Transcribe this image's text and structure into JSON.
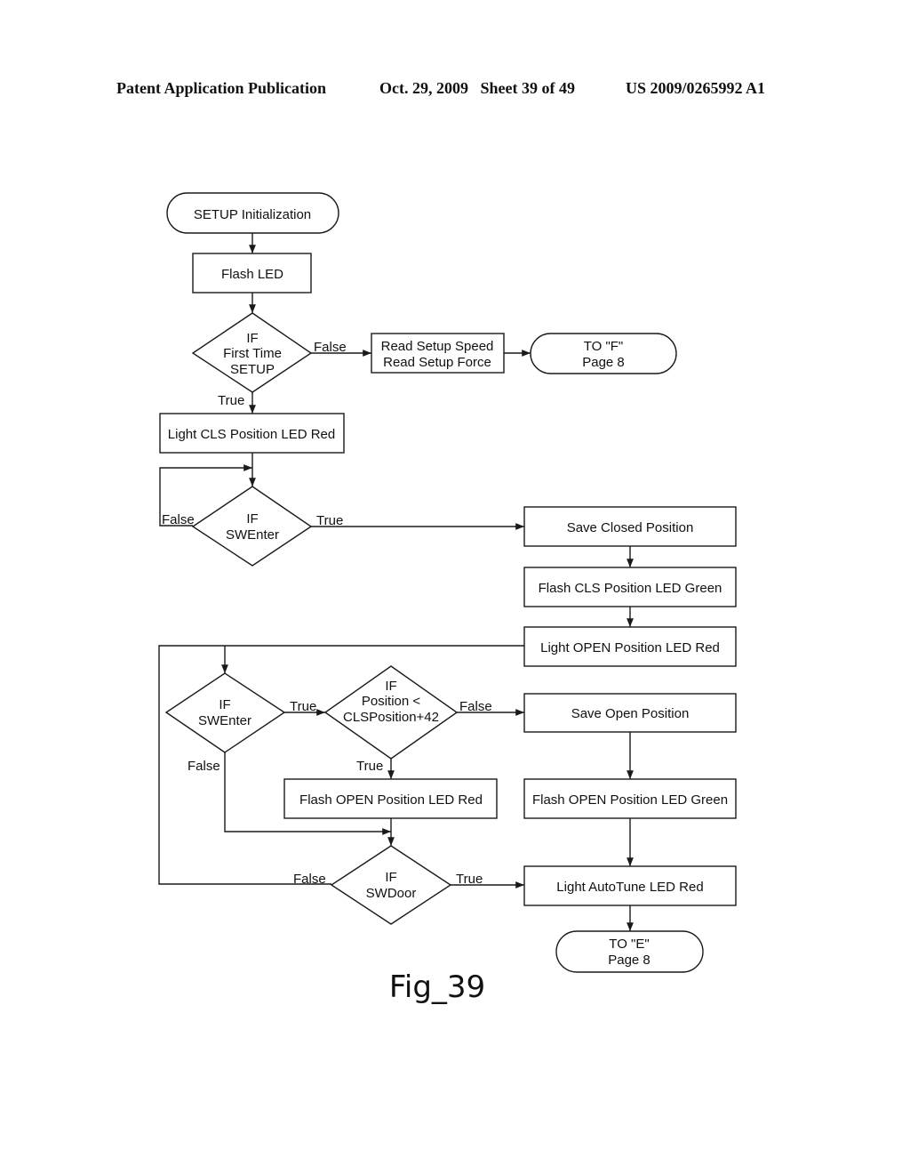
{
  "header": {
    "publication": "Patent Application Publication",
    "date_sheet": "Oct. 29, 2009   Sheet 39 of 49",
    "patent_number": "US 2009/0265992 A1"
  },
  "figure_label": "Fig_39",
  "nodes": {
    "start": {
      "type": "terminator",
      "lines": [
        "SETUP Initialization"
      ]
    },
    "flash_led": {
      "type": "process",
      "lines": [
        "Flash LED"
      ]
    },
    "if_first_time_setup": {
      "type": "decision",
      "lines": [
        "IF",
        "First Time",
        "SETUP"
      ]
    },
    "read_setup": {
      "type": "process",
      "lines": [
        "Read Setup Speed",
        "Read Setup Force"
      ]
    },
    "to_f": {
      "type": "terminator",
      "lines": [
        "TO \"F\"",
        "Page 8"
      ]
    },
    "light_cls_red": {
      "type": "process",
      "lines": [
        "Light CLS Position LED Red"
      ]
    },
    "if_swenter_1": {
      "type": "decision",
      "lines": [
        "IF",
        "SWEnter"
      ]
    },
    "save_closed": {
      "type": "process",
      "lines": [
        "Save Closed Position"
      ]
    },
    "flash_cls_green": {
      "type": "process",
      "lines": [
        "Flash CLS Position LED Green"
      ]
    },
    "light_open_red": {
      "type": "process",
      "lines": [
        "Light OPEN Position LED Red"
      ]
    },
    "if_swenter_2": {
      "type": "decision",
      "lines": [
        "IF",
        "SWEnter"
      ]
    },
    "if_position": {
      "type": "decision",
      "lines": [
        "IF",
        "Position <",
        "CLSPosition+42"
      ]
    },
    "save_open": {
      "type": "process",
      "lines": [
        "Save Open Position"
      ]
    },
    "flash_open_red": {
      "type": "process",
      "lines": [
        "Flash OPEN Position LED Red"
      ]
    },
    "flash_open_green": {
      "type": "process",
      "lines": [
        "Flash OPEN Position LED Green"
      ]
    },
    "if_swdoor": {
      "type": "decision",
      "lines": [
        "IF",
        "SWDoor"
      ]
    },
    "light_autotune_red": {
      "type": "process",
      "lines": [
        "Light AutoTune LED Red"
      ]
    },
    "to_e": {
      "type": "terminator",
      "lines": [
        "TO \"E\"",
        "Page 8"
      ]
    }
  },
  "edges": [
    {
      "from": "start",
      "to": "flash_led",
      "label": ""
    },
    {
      "from": "flash_led",
      "to": "if_first_time_setup",
      "label": ""
    },
    {
      "from": "if_first_time_setup",
      "to": "read_setup",
      "label": "False"
    },
    {
      "from": "read_setup",
      "to": "to_f",
      "label": ""
    },
    {
      "from": "if_first_time_setup",
      "to": "light_cls_red",
      "label": "True"
    },
    {
      "from": "light_cls_red",
      "to": "if_swenter_1",
      "label": ""
    },
    {
      "from": "if_swenter_1",
      "to": "if_swenter_1",
      "label": "False"
    },
    {
      "from": "if_swenter_1",
      "to": "save_closed",
      "label": "True"
    },
    {
      "from": "save_closed",
      "to": "flash_cls_green",
      "label": ""
    },
    {
      "from": "flash_cls_green",
      "to": "light_open_red",
      "label": ""
    },
    {
      "from": "light_open_red",
      "to": "if_swenter_2",
      "label": ""
    },
    {
      "from": "if_swenter_2",
      "to": "if_position",
      "label": "True"
    },
    {
      "from": "if_swenter_2",
      "to": "if_swdoor",
      "label": "False"
    },
    {
      "from": "if_position",
      "to": "save_open",
      "label": "False"
    },
    {
      "from": "if_position",
      "to": "flash_open_red",
      "label": "True"
    },
    {
      "from": "flash_open_red",
      "to": "if_swdoor",
      "label": ""
    },
    {
      "from": "save_open",
      "to": "flash_open_green",
      "label": ""
    },
    {
      "from": "flash_open_green",
      "to": "light_autotune_red",
      "label": ""
    },
    {
      "from": "if_swdoor",
      "to": "light_autotune_red",
      "label": "True"
    },
    {
      "from": "if_swdoor",
      "to": "if_swenter_2",
      "label": "False"
    },
    {
      "from": "light_autotune_red",
      "to": "to_e",
      "label": ""
    }
  ]
}
